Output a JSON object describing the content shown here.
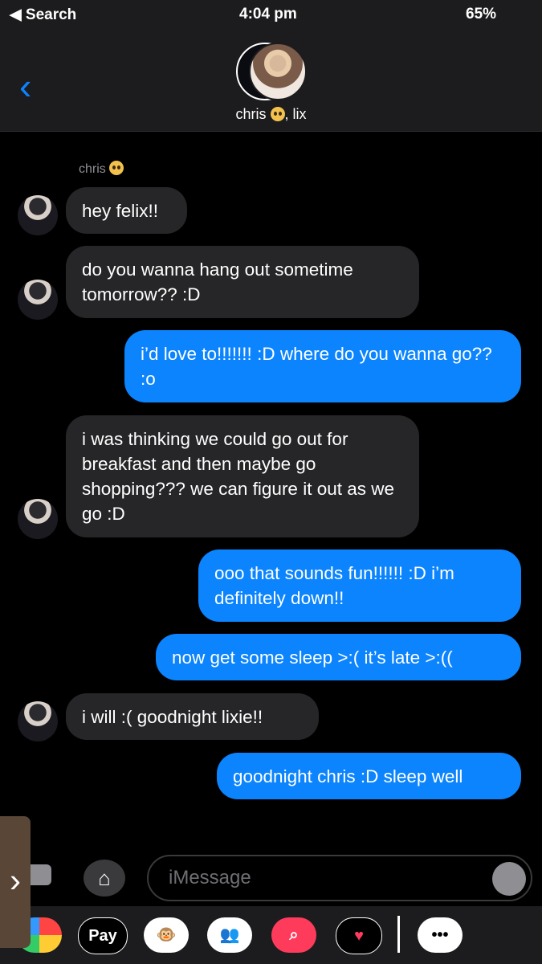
{
  "status_bar": {
    "back_app": "◀ Search",
    "time": "4:04 pm",
    "battery": "65%"
  },
  "header": {
    "contact_name": "chris",
    "contact_name_suffix": ", lix"
  },
  "thread": {
    "sender_label": "chris",
    "messages": [
      {
        "direction": "incoming",
        "text": "hey felix!!"
      },
      {
        "direction": "incoming",
        "text": "do you wanna hang out sometime tomorrow?? :D"
      },
      {
        "direction": "outgoing",
        "text": "i’d love to!!!!!!! :D where do you wanna go?? :o"
      },
      {
        "direction": "incoming",
        "text": "i was thinking we could go out for breakfast and then maybe go shopping??? we can figure it out as we go :D"
      },
      {
        "direction": "outgoing",
        "text": "ooo that sounds fun!!!!!! :D i’m definitely down!!"
      },
      {
        "direction": "outgoing",
        "text": "now get some sleep >:( it’s late >:(("
      },
      {
        "direction": "incoming",
        "text": "i will :( goodnight lixie!!"
      },
      {
        "direction": "outgoing",
        "text": "goodnight chris :D sleep well"
      }
    ]
  },
  "composer": {
    "placeholder": "iMessage",
    "icons": [
      "camera-icon",
      "app-store-icon",
      "audio-message-icon"
    ]
  },
  "app_tray": {
    "items": [
      "photos-icon",
      "Pay",
      "animoji-icon",
      "memoji-icon",
      "image-search-icon",
      "digital-touch-icon",
      "more-icon"
    ]
  },
  "colors": {
    "incoming_bubble": "#262628",
    "outgoing_bubble": "#0b84fe",
    "accent": "#0a84ff"
  }
}
